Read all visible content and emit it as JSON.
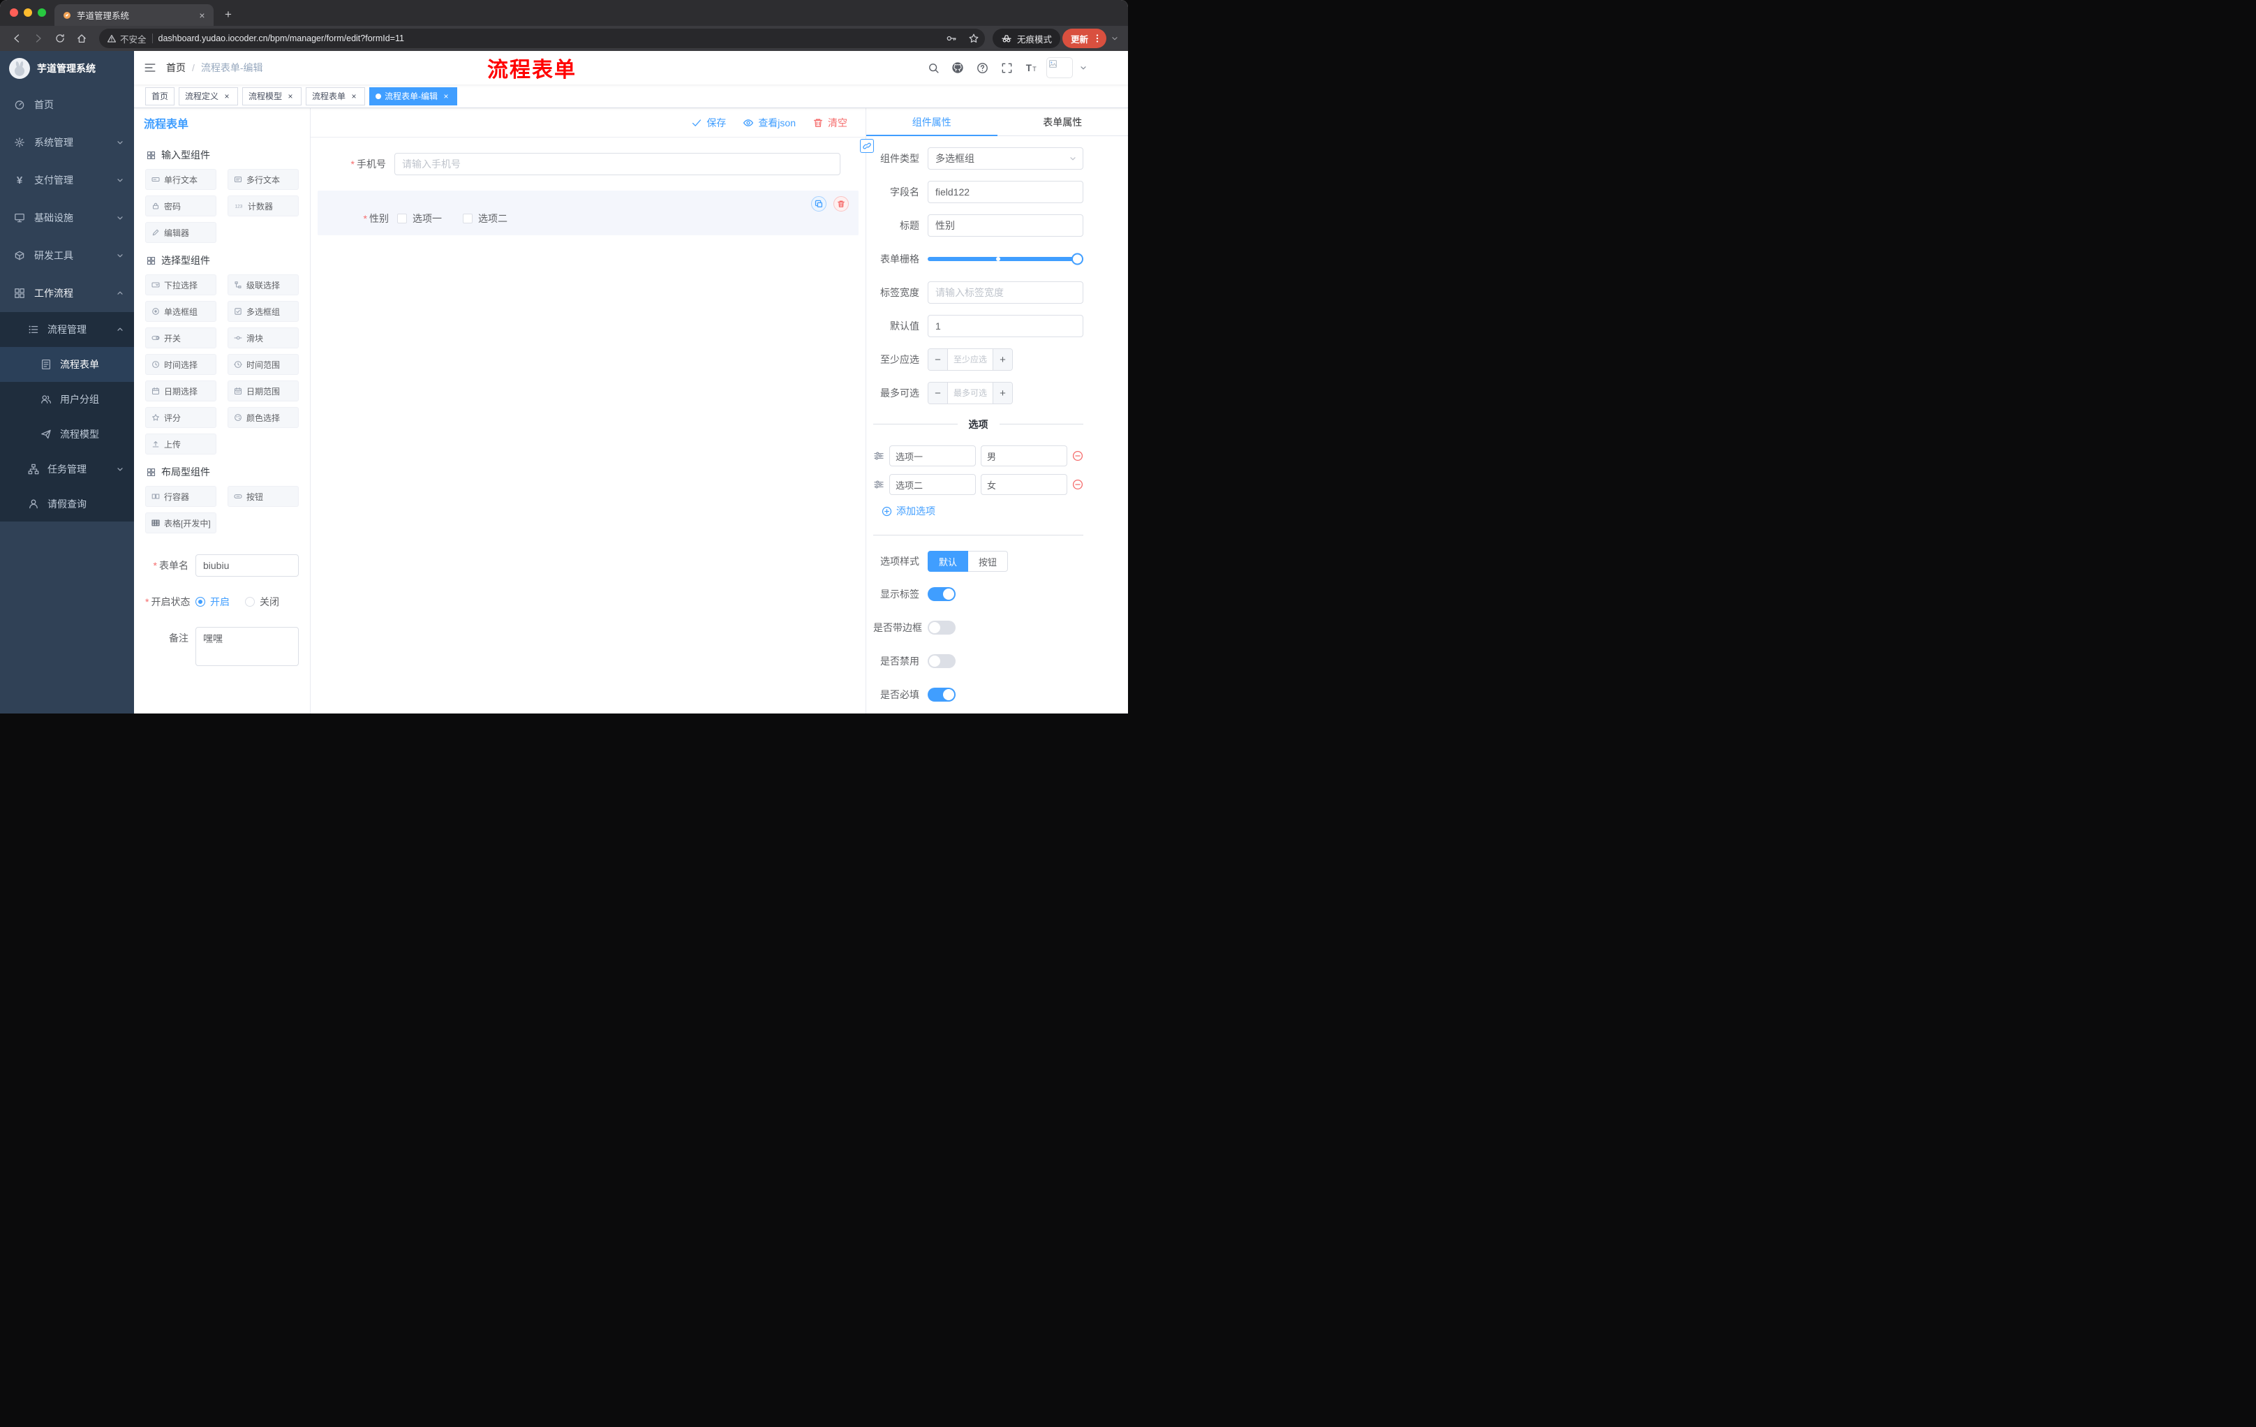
{
  "colors": {
    "primary": "#409EFF",
    "danger": "#F56C6C",
    "annotation_red": "#FF0000",
    "sidebar_bg": "#304156",
    "submenu_bg": "#1F2D3D",
    "active_tag_bg": "#409EFF",
    "update_chip_bg": "#D9503F"
  },
  "icons": {
    "save": "check",
    "view_json": "eye",
    "clear": "trash",
    "copy_component": "copy",
    "delete_component": "trash",
    "add_option": "plus-circle",
    "remove_option": "minus-circle",
    "option_drag": "sliders",
    "props_link": "link",
    "navbar": [
      "search",
      "github",
      "question-circle",
      "fullscreen",
      "font-size"
    ],
    "browser": [
      "back-arrow",
      "forward-arrow",
      "reload",
      "home",
      "warning-triangle",
      "key",
      "star",
      "incognito",
      "dots-vertical"
    ]
  },
  "browser": {
    "tab_title": "芋道管理系统",
    "security_label": "不安全",
    "url": "dashboard.yudao.iocoder.cn/bpm/manager/form/edit?formId=11",
    "incognito_label": "无痕模式",
    "update_label": "更新"
  },
  "sidebar": {
    "logo_title": "芋道管理系统",
    "menu": [
      {
        "label": "首页"
      },
      {
        "label": "系统管理"
      },
      {
        "label": "支付管理"
      },
      {
        "label": "基础设施"
      },
      {
        "label": "研发工具"
      },
      {
        "label": "工作流程"
      }
    ],
    "submenu": [
      {
        "label": "流程管理"
      },
      {
        "label": "流程表单"
      },
      {
        "label": "用户分组"
      },
      {
        "label": "流程模型"
      },
      {
        "label": "任务管理"
      },
      {
        "label": "请假查询"
      }
    ]
  },
  "navbar": {
    "breadcrumb_home": "首页",
    "breadcrumb_separator": "/",
    "breadcrumb_current": "流程表单-编辑"
  },
  "annotation": {
    "text": "流程表单"
  },
  "tags": [
    {
      "label": "首页"
    },
    {
      "label": "流程定义"
    },
    {
      "label": "流程模型"
    },
    {
      "label": "流程表单"
    },
    {
      "label": "流程表单-编辑"
    }
  ],
  "designer": {
    "title": "流程表单",
    "actions": {
      "save": "保存",
      "view_json": "查看json",
      "clear": "清空"
    },
    "palette": {
      "sections": [
        {
          "title": "输入型组件",
          "items": [
            "单行文本",
            "多行文本",
            "密码",
            "计数器",
            "编辑器"
          ]
        },
        {
          "title": "选择型组件",
          "items": [
            "下拉选择",
            "级联选择",
            "单选框组",
            "多选框组",
            "开关",
            "滑块",
            "时间选择",
            "时间范围",
            "日期选择",
            "日期范围",
            "评分",
            "颜色选择",
            "上传"
          ]
        },
        {
          "title": "布局型组件",
          "items": [
            "行容器",
            "按钮",
            "表格[开发中]"
          ]
        }
      ]
    },
    "meta": {
      "form_name_label": "表单名",
      "form_name_value": "biubiu",
      "status_label": "开启状态",
      "status_on": "开启",
      "status_off": "关闭",
      "remark_label": "备注",
      "remark_value": "嘿嘿"
    },
    "canvas": {
      "phone_label": "手机号",
      "phone_placeholder": "请输入手机号",
      "gender_label": "性别",
      "gender_option1": "选项一",
      "gender_option2": "选项二"
    }
  },
  "props": {
    "tab_component": "组件属性",
    "tab_form": "表单属性",
    "component_type_label": "组件类型",
    "component_type_value": "多选框组",
    "field_name_label": "字段名",
    "field_name_value": "field122",
    "title_label": "标题",
    "title_value": "性别",
    "grid_label": "表单栅格",
    "label_width_label": "标签宽度",
    "label_width_placeholder": "请输入标签宽度",
    "default_label": "默认值",
    "default_value": "1",
    "min_label": "至少应选",
    "min_placeholder": "至少应选",
    "max_label": "最多可选",
    "max_placeholder": "最多可选",
    "options_title": "选项",
    "options": [
      {
        "name": "选项一",
        "value": "男"
      },
      {
        "name": "选项二",
        "value": "女"
      }
    ],
    "add_option": "添加选项",
    "style_label": "选项样式",
    "style_default": "默认",
    "style_button": "按钮",
    "switch_show_label": "显示标签",
    "switch_border": "是否带边框",
    "switch_disabled": "是否禁用",
    "switch_required": "是否必填"
  }
}
